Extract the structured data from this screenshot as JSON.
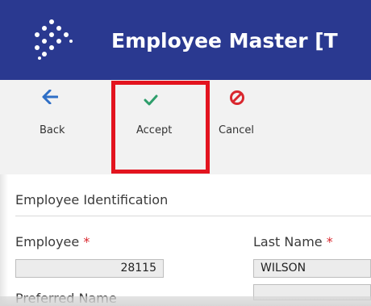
{
  "app": {
    "title": "Employee Master [T"
  },
  "toolbar": {
    "back_label": "Back",
    "accept_label": "Accept",
    "cancel_label": "Cancel"
  },
  "section": {
    "title": "Employee Identification"
  },
  "fields": {
    "employee": {
      "label": "Employee",
      "required_mark": "*",
      "value": "28115"
    },
    "last_name": {
      "label": "Last Name",
      "required_mark": "*",
      "value": "WILSON"
    },
    "preferred_name": {
      "label": "Preferred Name",
      "value": ""
    }
  },
  "colors": {
    "title_bar": "#2a3990",
    "back_icon": "#2f6fc6",
    "accept_icon": "#2e9e6b",
    "cancel_icon": "#d9272e",
    "highlight": "#e3141f"
  }
}
